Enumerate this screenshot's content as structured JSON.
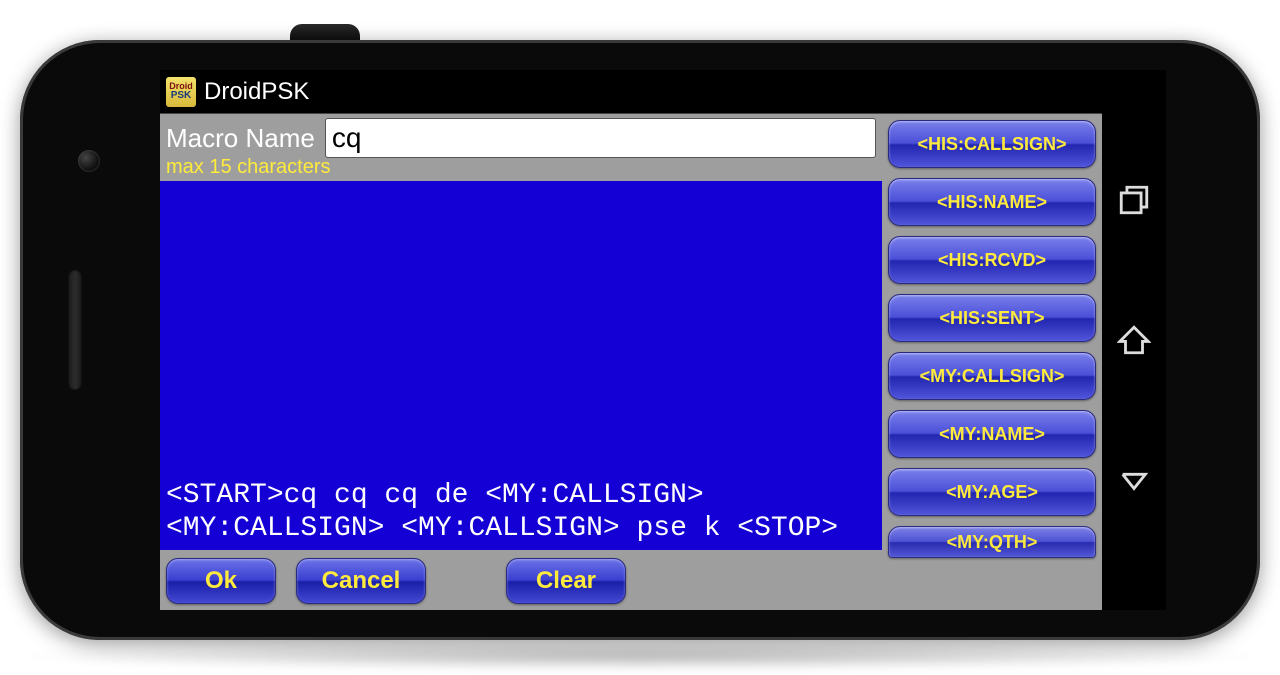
{
  "app": {
    "icon_line1": "Droid",
    "icon_line2": "PSK",
    "title": "DroidPSK"
  },
  "macro": {
    "label": "Macro Name",
    "hint": "max 15 characters",
    "value": "cq"
  },
  "editor_text": "<START>cq cq cq de <MY:CALLSIGN> <MY:CALLSIGN> <MY:CALLSIGN> pse k <STOP>",
  "buttons": {
    "ok": "Ok",
    "cancel": "Cancel",
    "clear": "Clear"
  },
  "tokens": [
    "<HIS:CALLSIGN>",
    "<HIS:NAME>",
    "<HIS:RCVD>",
    "<HIS:SENT>",
    "<MY:CALLSIGN>",
    "<MY:NAME>",
    "<MY:AGE>",
    "<MY:QTH>"
  ]
}
